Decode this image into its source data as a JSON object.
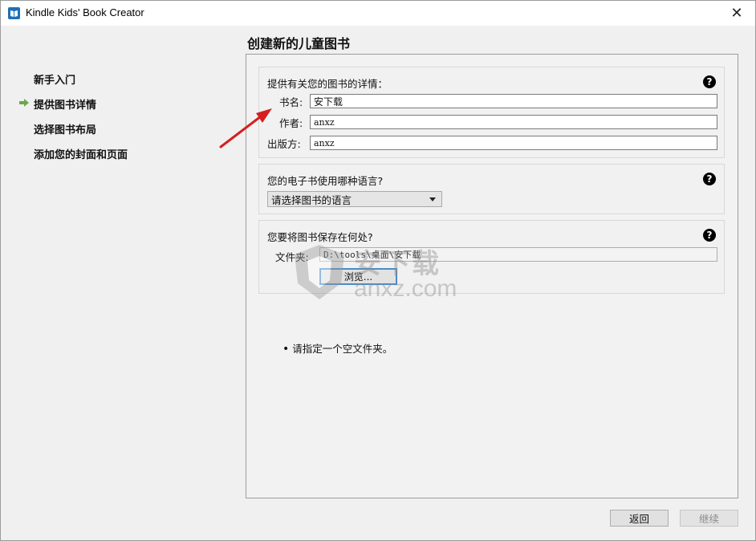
{
  "window": {
    "title": "Kindle Kids' Book Creator",
    "close_glyph": "✕"
  },
  "page_title": "创建新的儿童图书",
  "sidebar": {
    "items": [
      {
        "label": "新手入门"
      },
      {
        "label": "提供图书详情",
        "active": true
      },
      {
        "label": "选择图书布局"
      },
      {
        "label": "添加您的封面和页面"
      }
    ],
    "active_icon": "green-arrow-right-icon"
  },
  "details": {
    "heading": "提供有关您的图书的详情：",
    "help_glyph": "?",
    "title_label": "书名:",
    "title_value": "安下载",
    "author_label": "作者:",
    "author_value": "anxz",
    "publisher_label": "出版方:",
    "publisher_value": "anxz"
  },
  "language": {
    "heading": "您的电子书使用哪种语言?",
    "help_glyph": "?",
    "selected": "请选择图书的语言"
  },
  "save": {
    "heading": "您要将图书保存在何处?",
    "help_glyph": "?",
    "folder_label": "文件夹:",
    "folder_value": "D:\\tools\\桌面\\安下载",
    "browse_label": "浏览..."
  },
  "note": {
    "bullet": "•",
    "text": "请指定一个空文件夹。"
  },
  "buttons": {
    "back": "返回",
    "next": "继续"
  },
  "watermark": {
    "chars": "安下载",
    "text": "anxz.com"
  },
  "colors": {
    "accent_arrow": "#6aa84f",
    "annotation": "#d42020",
    "focus": "#4a8bc8"
  }
}
